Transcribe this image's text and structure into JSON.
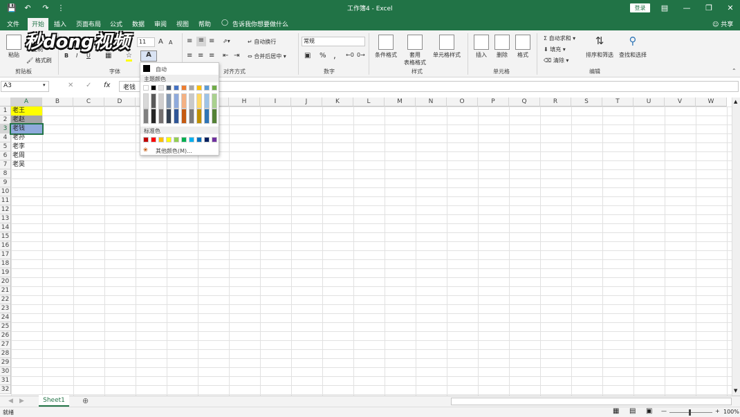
{
  "window": {
    "title": "工作簿4 - Excel",
    "login_label": "登录",
    "share_label": "共享"
  },
  "menu": {
    "tabs": [
      "文件",
      "开始",
      "插入",
      "页面布局",
      "公式",
      "数据",
      "审阅",
      "视图",
      "帮助"
    ],
    "active": "开始",
    "tell_me": "告诉我你想要做什么"
  },
  "ribbon": {
    "groups": [
      "剪贴板",
      "字体",
      "对齐方式",
      "数字",
      "样式",
      "单元格",
      "编辑"
    ],
    "clipboard": {
      "paste": "粘贴",
      "copy": "复制",
      "format_painter": "格式刷"
    },
    "font": {
      "size": "11",
      "bold": "B",
      "italic": "I",
      "underline": "U",
      "grow": "A",
      "shrink": "A"
    },
    "alignment": {
      "wrap": "自动换行",
      "merge": "合并后居中"
    },
    "number": {
      "format": "常规",
      "percent": "%",
      "comma": ","
    },
    "styles": {
      "conditional": "条件格式",
      "table1": "套用",
      "table2": "表格格式",
      "cell_styles": "单元格样式"
    },
    "cells": {
      "insert": "插入",
      "delete": "删除",
      "format": "格式"
    },
    "editing": {
      "autosum": "自动求和",
      "fill": "填充",
      "clear": "清除",
      "sort": "排序和筛选",
      "find": "查找和选择"
    }
  },
  "formula_bar": {
    "name_box": "A3",
    "fx": "fx",
    "value": "老钱"
  },
  "grid": {
    "columns": [
      "A",
      "B",
      "C",
      "D",
      "E",
      "F",
      "G",
      "H",
      "I",
      "J",
      "K",
      "L",
      "M",
      "N",
      "O",
      "P",
      "Q",
      "R",
      "S",
      "T",
      "U",
      "V",
      "W"
    ],
    "rows": [
      "1",
      "2",
      "3",
      "4",
      "5",
      "6",
      "7",
      "8",
      "9",
      "10",
      "11",
      "12",
      "13",
      "14",
      "15",
      "16",
      "17",
      "18",
      "19",
      "20",
      "21",
      "22",
      "23",
      "24",
      "25",
      "26",
      "27",
      "28",
      "29",
      "30",
      "31",
      "32"
    ],
    "cells": [
      {
        "text": "老王",
        "bg": "#ffff00"
      },
      {
        "text": "老赵",
        "bg": "#a5a5a5"
      },
      {
        "text": "老钱",
        "bg": "#8faadc"
      },
      {
        "text": "老孙",
        "bg": ""
      },
      {
        "text": "老李",
        "bg": ""
      },
      {
        "text": "老周",
        "bg": ""
      },
      {
        "text": "老吴",
        "bg": ""
      }
    ]
  },
  "color_popup": {
    "auto": "自动",
    "theme_title": "主题颜色",
    "standard_title": "标准色",
    "more": "其他颜色(M)...",
    "theme_top": [
      "#ffffff",
      "#000000",
      "#e7e6e6",
      "#44546a",
      "#4472c4",
      "#ed7d31",
      "#a5a5a5",
      "#ffc000",
      "#5b9bd5",
      "#70ad47"
    ],
    "theme_mid": [
      "#d9d9d9",
      "#595959",
      "#d0cece",
      "#8497b0",
      "#8faadc",
      "#f4b183",
      "#c9c9c9",
      "#ffd966",
      "#9dc3e6",
      "#a9d18e"
    ],
    "theme_low": [
      "#808080",
      "#262626",
      "#767171",
      "#333f50",
      "#2f5597",
      "#c55a11",
      "#7b7b7b",
      "#bf9000",
      "#2e75b6",
      "#548235"
    ],
    "standard": [
      "#c00000",
      "#ff0000",
      "#ffc000",
      "#ffff00",
      "#92d050",
      "#00b050",
      "#00b0f0",
      "#0070c0",
      "#002060",
      "#7030a0"
    ]
  },
  "sheets": {
    "tab": "Sheet1"
  },
  "status": {
    "mode": "就绪",
    "zoom": "100%"
  },
  "watermark": "秒dong视频"
}
